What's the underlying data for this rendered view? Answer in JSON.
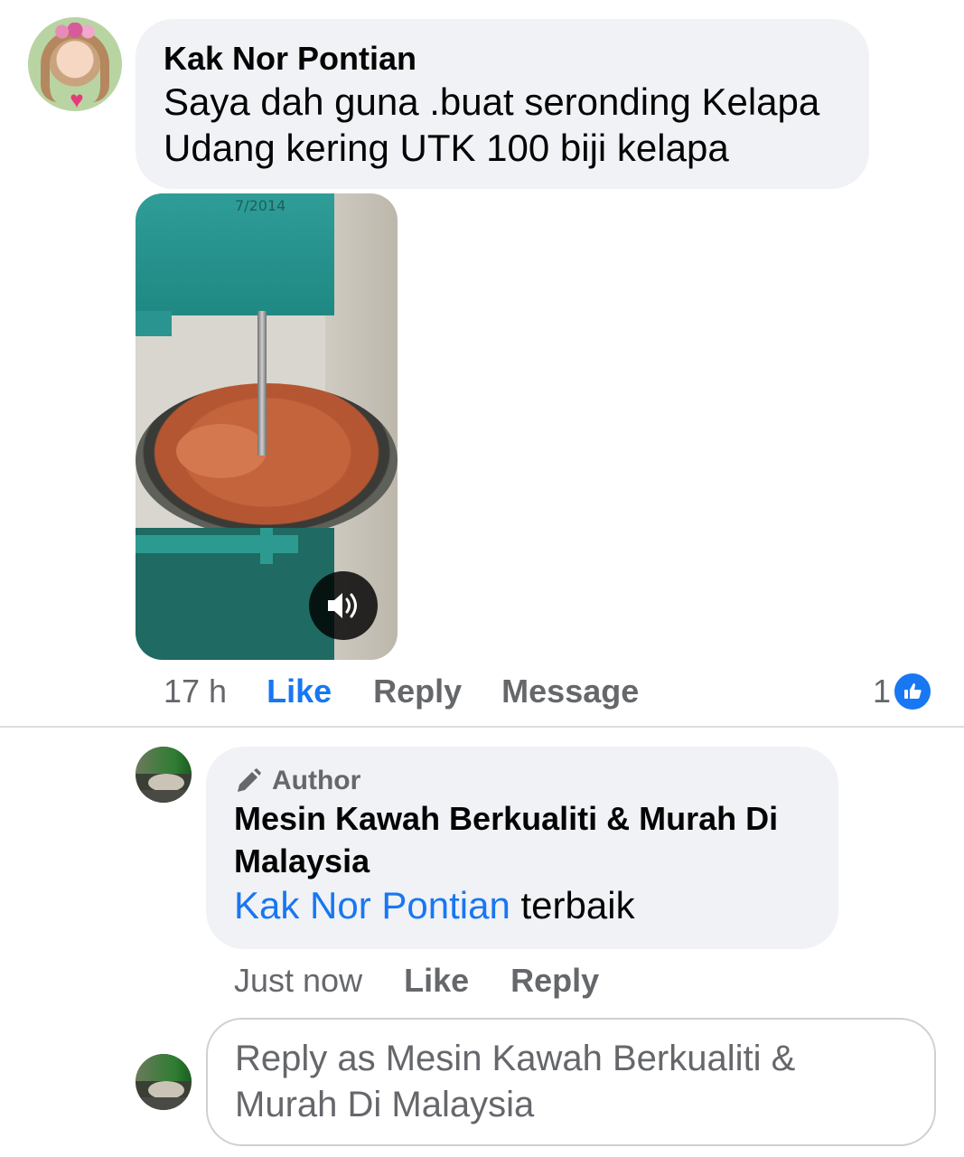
{
  "comment": {
    "author": "Kak Nor Pontian",
    "text": "Saya dah guna .buat seronding Kelapa Udang kering UTK 100 biji kelapa",
    "media_date_text": "7/2014",
    "time": "17 h",
    "actions": {
      "like": "Like",
      "reply": "Reply",
      "message": "Message"
    },
    "reaction_count": "1",
    "icons": {
      "sound": "speaker-icon",
      "reaction": "like-thumb-icon"
    }
  },
  "reply": {
    "badge": "Author",
    "author": "Mesin Kawah Berkualiti & Murah Di Malaysia",
    "mention": "Kak Nor Pontian",
    "text": " terbaik",
    "time": "Just now",
    "actions": {
      "like": "Like",
      "reply": "Reply"
    }
  },
  "composer": {
    "placeholder": "Reply as Mesin Kawah Berkualiti & Murah Di Malaysia"
  },
  "colors": {
    "accent": "#1877f2",
    "bubble": "#f0f2f5",
    "muted": "#65676b"
  }
}
